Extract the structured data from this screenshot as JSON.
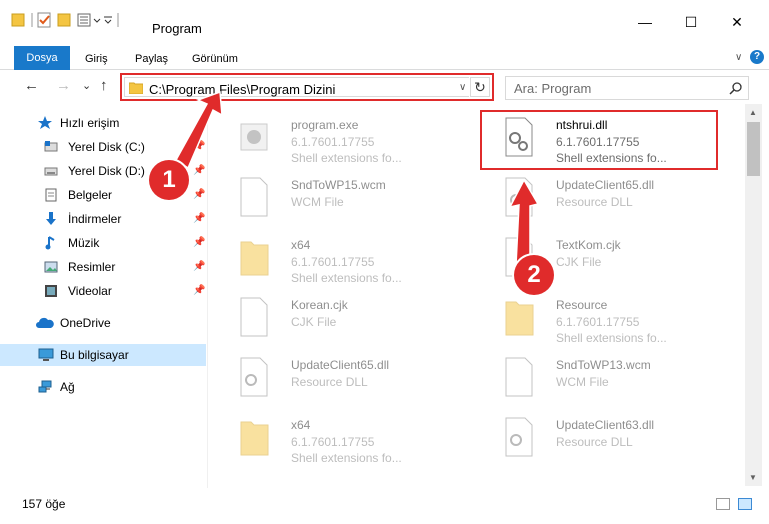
{
  "window": {
    "title": "Program",
    "minimize": "—",
    "maximize": "☐",
    "close": "✕"
  },
  "ribbon": {
    "tabs": [
      "Dosya",
      "Giriş",
      "Paylaş",
      "Görünüm"
    ],
    "expand": "∨",
    "help": "?"
  },
  "nav": {
    "back": "←",
    "forward": "→",
    "recent": "⌄",
    "up": "↑",
    "address": "C:\\Program Files\\Program Dizini",
    "address_dropdown": "∨",
    "refresh": "↻",
    "search_placeholder": "Ara: Program",
    "search_icon": "search-icon"
  },
  "sidebar": {
    "items": [
      {
        "label": "Hızlı erişim",
        "icon": "star-icon"
      },
      {
        "label": "Yerel Disk (C:)",
        "icon": "drive-icon",
        "pinned": true
      },
      {
        "label": "Yerel Disk (D:)",
        "icon": "drive-icon",
        "pinned": true
      },
      {
        "label": "Belgeler",
        "icon": "documents-icon",
        "pinned": true
      },
      {
        "label": "İndirmeler",
        "icon": "downloads-icon",
        "pinned": true
      },
      {
        "label": "Müzik",
        "icon": "music-icon",
        "pinned": true
      },
      {
        "label": "Resimler",
        "icon": "pictures-icon",
        "pinned": true
      },
      {
        "label": "Videolar",
        "icon": "videos-icon",
        "pinned": true
      },
      {
        "label": "OneDrive",
        "icon": "cloud-icon"
      },
      {
        "label": "Bu bilgisayar",
        "icon": "computer-icon",
        "selected": true
      },
      {
        "label": "Ağ",
        "icon": "network-icon"
      }
    ],
    "pin_glyph": "📌"
  },
  "files": [
    {
      "name": "program.exe",
      "l2": "6.1.7601.17755",
      "l3": "Shell extensions fo...",
      "kind": "exe"
    },
    {
      "name": "ntshrui.dll",
      "l2": "6.1.7601.17755",
      "l3": "Shell extensions fo...",
      "kind": "dll",
      "highlighted": true
    },
    {
      "name": "SndToWP15.wcm",
      "l2": "WCM File",
      "l3": "",
      "kind": "blank"
    },
    {
      "name": "UpdateClient65.dll",
      "l2": "Resource DLL",
      "l3": "",
      "kind": "dll"
    },
    {
      "name": "x64",
      "l2": "6.1.7601.17755",
      "l3": "Shell extensions fo...",
      "kind": "folder"
    },
    {
      "name": "TextKom.cjk",
      "l2": "CJK File",
      "l3": "",
      "kind": "blank"
    },
    {
      "name": "Korean.cjk",
      "l2": "CJK File",
      "l3": "",
      "kind": "blank"
    },
    {
      "name": "Resource",
      "l2": "6.1.7601.17755",
      "l3": "Shell extensions fo...",
      "kind": "folder"
    },
    {
      "name": "UpdateClient65.dll",
      "l2": "Resource DLL",
      "l3": "",
      "kind": "dll"
    },
    {
      "name": "SndToWP13.wcm",
      "l2": "WCM File",
      "l3": "",
      "kind": "blank"
    },
    {
      "name": "x64",
      "l2": "6.1.7601.17755",
      "l3": "Shell extensions fo...",
      "kind": "folder"
    },
    {
      "name": "UpdateClient63.dll",
      "l2": "Resource DLL",
      "l3": "",
      "kind": "dll"
    }
  ],
  "status": {
    "count": "157 öğe"
  },
  "annotations": {
    "step1": "1",
    "step2": "2",
    "color": "#e02b2b"
  }
}
